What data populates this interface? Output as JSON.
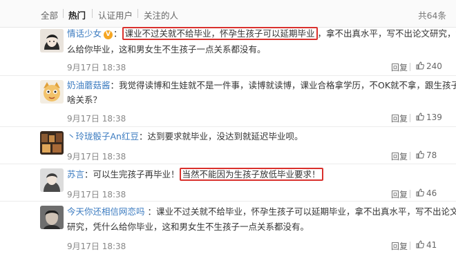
{
  "tabs": [
    {
      "label": "全部",
      "active": false
    },
    {
      "label": "热门",
      "active": true
    },
    {
      "label": "认证用户",
      "active": false
    },
    {
      "label": "关注的人",
      "active": false
    }
  ],
  "total_label": "共64条",
  "reply_label": "回复",
  "comments": [
    {
      "username": "情话少女",
      "badge": "V",
      "text_line1_highlight": "课业不过关就不给毕业，怀孕生孩子可以延期毕业",
      "text_line1_rest": "，拿不出真水平，写不出论文研究，凭什",
      "text_line2": "么给你毕业，这和男女生不生孩子一点关系都没有。",
      "time": "9月17日 18:38",
      "likes": "240"
    },
    {
      "username": "奶油蘑菇酱",
      "text_line1": "：我觉得读博和生娃就不是一件事，读博就读博，课业合格拿学历，不OK就不拿，跟生孩子",
      "text_line2": "啥关系？",
      "time": "9月17日 18:38",
      "likes": "139"
    },
    {
      "username": "丶玲珑骰子An红豆",
      "text_line1": "：达到要求就毕业，没达到就延迟毕业呗。",
      "time": "9月17日 18:38",
      "likes": "78"
    },
    {
      "username": "苏言",
      "text_line1_pre": "：可以生完孩子再毕业！",
      "text_line1_highlight": "当然不能因为生孩子放低毕业要求！",
      "time": "9月17日 18:38",
      "likes": "46"
    },
    {
      "username": "今天你还相信网恋吗",
      "text_line1": "：课业不过关就不给毕业，怀孕生孩子可以延期毕业，拿不出真水平，写不出论文",
      "text_line2": "研究，凭什么给你毕业，这和男女生不生孩子一点关系都没有。",
      "time": "9月17日 18:38",
      "likes": "41"
    }
  ],
  "colors": {
    "link": "#3b7bc0",
    "highlight_border": "#d9302c",
    "badge": "#f5a623"
  },
  "icons": [
    "verified-badge-icon",
    "thumbs-up-icon",
    "avatar-icon"
  ]
}
